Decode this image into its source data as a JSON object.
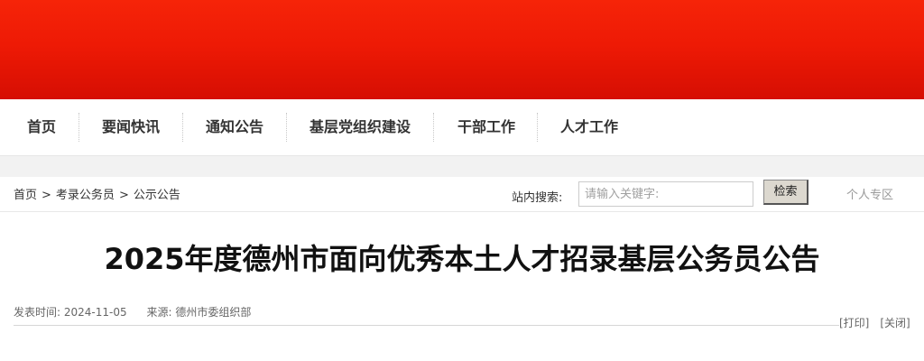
{
  "nav": {
    "items": [
      {
        "label": "首页"
      },
      {
        "label": "要闻快讯"
      },
      {
        "label": "通知公告"
      },
      {
        "label": "基层党组织建设"
      },
      {
        "label": "干部工作"
      },
      {
        "label": "人才工作"
      }
    ]
  },
  "breadcrumb": {
    "items": [
      "首页",
      "考录公务员",
      "公示公告"
    ],
    "separator": ">"
  },
  "search": {
    "label": "站内搜索:",
    "placeholder": "请输入关键字:",
    "button": "检索"
  },
  "personal_link": "个人专区",
  "article": {
    "title": "2025年度德州市面向优秀本土人才招录基层公务员公告",
    "publish_label": "发表时间:",
    "publish_date": "2024-11-05",
    "source_label": "来源:",
    "source": "德州市委组织部",
    "print": "[打印]",
    "close": "[关闭]"
  },
  "colors": {
    "banner": "#ee1a05",
    "button_bg": "#dcd8cf"
  }
}
